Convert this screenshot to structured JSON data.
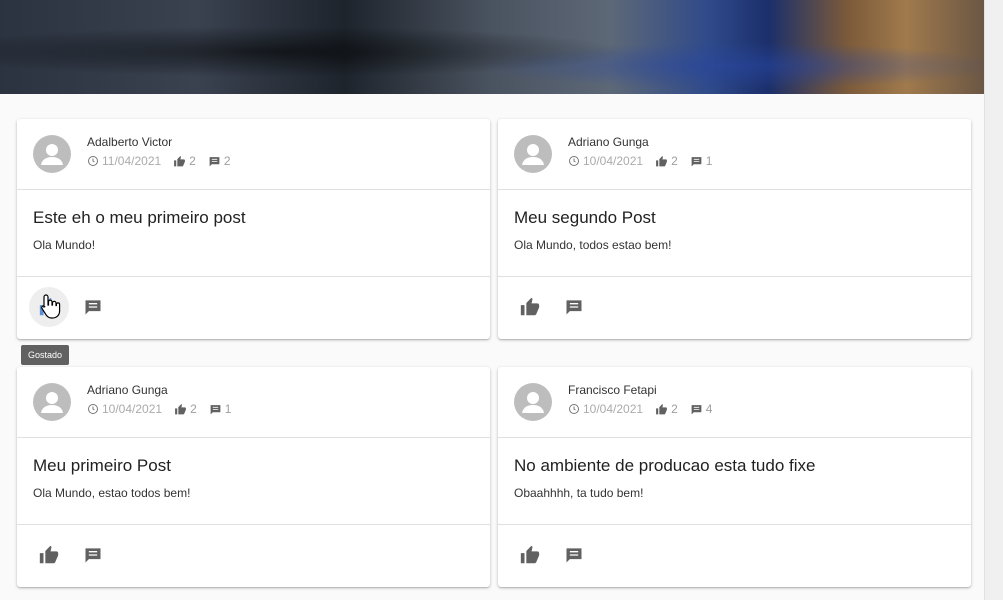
{
  "tooltip": "Gostado",
  "posts": [
    {
      "author": "Adalberto Victor",
      "date": "11/04/2021",
      "likes": "2",
      "comments": "2",
      "title": "Este eh o meu primeiro post",
      "text": "Ola Mundo!",
      "liked": true
    },
    {
      "author": "Adriano Gunga",
      "date": "10/04/2021",
      "likes": "2",
      "comments": "1",
      "title": "Meu segundo Post",
      "text": "Ola Mundo, todos estao bem!",
      "liked": false
    },
    {
      "author": "Adriano Gunga",
      "date": "10/04/2021",
      "likes": "2",
      "comments": "1",
      "title": "Meu primeiro Post",
      "text": "Ola Mundo, estao todos bem!",
      "liked": false
    },
    {
      "author": "Francisco Fetapi",
      "date": "10/04/2021",
      "likes": "2",
      "comments": "4",
      "title": "No ambiente de producao esta tudo fixe",
      "text": "Obaahhhh, ta tudo bem!",
      "liked": false
    }
  ],
  "colors": {
    "liked": "#5c8fd6",
    "icon": "#616161",
    "meta_icon": "#9e9e9e"
  },
  "icons": [
    "clock-icon",
    "thumb-up-icon",
    "comment-icon",
    "person-icon"
  ]
}
